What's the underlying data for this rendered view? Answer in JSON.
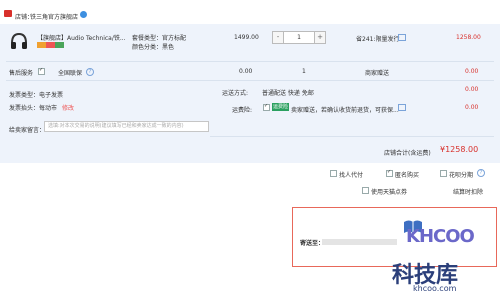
{
  "shop": {
    "label": "店铺：",
    "name": "铁三角官方旗舰店"
  },
  "product": {
    "title": "【旗舰店】Audio Technica/铁...",
    "spec_type": "套餐类型：官方标配",
    "spec_color": "颜色分类：黑色",
    "price": "1499.00",
    "quantity": "1",
    "minus_label": "-",
    "plus_label": "+",
    "discount": "省241:限量发行",
    "total": "1258.00"
  },
  "service": {
    "label": "售后服务",
    "option": "全国联保",
    "price": "0.00",
    "qty": "1",
    "note": "商家赠送",
    "total": "0.00"
  },
  "invoice": {
    "type": "发票类型：电子发票",
    "title": "发票抬头：每动市",
    "edit_link": "修改"
  },
  "shipping": {
    "label": "运送方式:",
    "value": "普通配送 快递 免邮",
    "total": "0.00"
  },
  "insurance": {
    "label": "运费险:",
    "badge": "运费险",
    "text": "卖家赠送，若确认收货前退货，可获保...",
    "total": "0.00"
  },
  "message": {
    "label": "给卖家留言：",
    "placeholder": "选填:对本次交易的说明(建议填写已经和卖家达成一致的内容)"
  },
  "subtotal": {
    "label": "店铺合计(含运费)",
    "amount": "¥1258.00"
  },
  "options": {
    "proxy_pay": "找人代付",
    "anonymous": "匿名购买",
    "huabei": "花呗分期",
    "tmall_points": "使用天猫点券",
    "checkout": "结算时扣除"
  },
  "address": {
    "label": "寄送至："
  },
  "watermark": {
    "logo": "KHCOO",
    "cn": "科技库",
    "url": "khcoo.com"
  },
  "colors": {
    "price_red": "#d8302b",
    "panel_bg": "#eef3fb",
    "address_border": "#e8685a"
  }
}
